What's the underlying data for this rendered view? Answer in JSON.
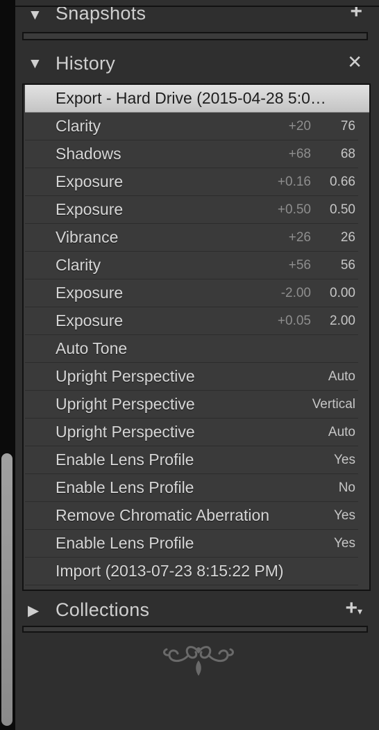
{
  "snapshots": {
    "title": "Snapshots",
    "add_icon": "plus-icon"
  },
  "history": {
    "title": "History",
    "clear_icon": "close-x-icon",
    "items": [
      {
        "name": "Export - Hard Drive (2015-04-28 5:0…",
        "delta": "",
        "value": ""
      },
      {
        "name": "Clarity",
        "delta": "+20",
        "value": "76"
      },
      {
        "name": "Shadows",
        "delta": "+68",
        "value": "68"
      },
      {
        "name": "Exposure",
        "delta": "+0.16",
        "value": "0.66"
      },
      {
        "name": "Exposure",
        "delta": "+0.50",
        "value": "0.50"
      },
      {
        "name": "Vibrance",
        "delta": "+26",
        "value": "26"
      },
      {
        "name": "Clarity",
        "delta": "+56",
        "value": "56"
      },
      {
        "name": "Exposure",
        "delta": "-2.00",
        "value": "0.00"
      },
      {
        "name": "Exposure",
        "delta": "+0.05",
        "value": "2.00"
      },
      {
        "name": "Auto Tone",
        "delta": "",
        "value": ""
      },
      {
        "name": "Upright Perspective",
        "delta": "",
        "value": "Auto"
      },
      {
        "name": "Upright Perspective",
        "delta": "",
        "value": "Vertical"
      },
      {
        "name": "Upright Perspective",
        "delta": "",
        "value": "Auto"
      },
      {
        "name": "Enable Lens Profile",
        "delta": "",
        "value": "Yes"
      },
      {
        "name": "Enable Lens Profile",
        "delta": "",
        "value": "No"
      },
      {
        "name": "Remove Chromatic Aberration",
        "delta": "",
        "value": "Yes"
      },
      {
        "name": "Enable Lens Profile",
        "delta": "",
        "value": "Yes"
      },
      {
        "name": "Import (2013-07-23 8:15:22 PM)",
        "delta": "",
        "value": ""
      }
    ]
  },
  "collections": {
    "title": "Collections",
    "add_icon": "plus-dropdown-icon"
  },
  "colors": {
    "panel_bg": "#2f2f2f",
    "selected_row": "#d8d8d8",
    "text": "#d6d6d6"
  }
}
